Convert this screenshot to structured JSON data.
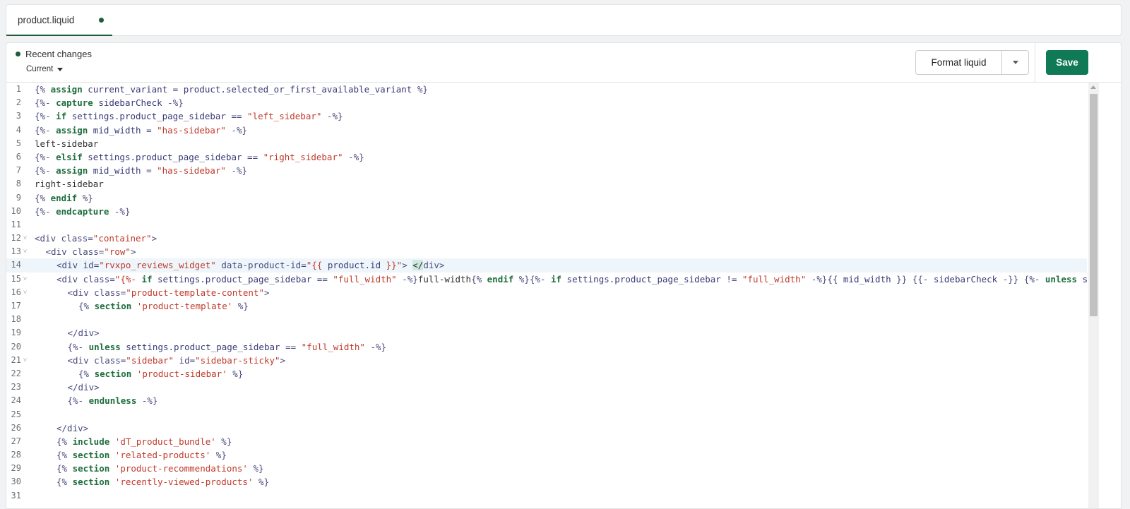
{
  "tabs": [
    {
      "label": "product.liquid",
      "unsaved": true
    }
  ],
  "toolbar": {
    "recent_changes_label": "Recent changes",
    "version_select": "Current",
    "format_label": "Format liquid",
    "save_label": "Save"
  },
  "editor": {
    "active_line": 14,
    "lines": [
      {
        "n": "1",
        "fold": false,
        "indent": 0,
        "parts": [
          [
            "mt",
            "{% "
          ],
          [
            "kw",
            "assign"
          ],
          [
            "vr",
            " current_variant "
          ],
          [
            "mt",
            "= "
          ],
          [
            "vr",
            "product.selected_or_first_available_variant"
          ],
          [
            "mt",
            " %}"
          ]
        ]
      },
      {
        "n": "2",
        "fold": false,
        "indent": 0,
        "parts": [
          [
            "mt",
            "{%- "
          ],
          [
            "kw",
            "capture"
          ],
          [
            "vr",
            " sidebarCheck"
          ],
          [
            "mt",
            " -%}"
          ]
        ]
      },
      {
        "n": "3",
        "fold": false,
        "indent": 0,
        "parts": [
          [
            "mt",
            "{%- "
          ],
          [
            "kw",
            "if"
          ],
          [
            "vr",
            " settings.product_page_sidebar "
          ],
          [
            "mt",
            "== "
          ],
          [
            "st",
            "\"left_sidebar\""
          ],
          [
            "mt",
            " -%}"
          ]
        ]
      },
      {
        "n": "4",
        "fold": false,
        "indent": 0,
        "parts": [
          [
            "mt",
            "{%- "
          ],
          [
            "kw",
            "assign"
          ],
          [
            "vr",
            " mid_width "
          ],
          [
            "mt",
            "= "
          ],
          [
            "st",
            "\"has-sidebar\""
          ],
          [
            "mt",
            " -%}"
          ]
        ]
      },
      {
        "n": "5",
        "fold": false,
        "indent": 0,
        "parts": [
          [
            "pl",
            "left-sidebar"
          ]
        ]
      },
      {
        "n": "6",
        "fold": false,
        "indent": 0,
        "parts": [
          [
            "mt",
            "{%- "
          ],
          [
            "kw",
            "elsif"
          ],
          [
            "vr",
            " settings.product_page_sidebar "
          ],
          [
            "mt",
            "== "
          ],
          [
            "st",
            "\"right_sidebar\""
          ],
          [
            "mt",
            " -%}"
          ]
        ]
      },
      {
        "n": "7",
        "fold": false,
        "indent": 0,
        "parts": [
          [
            "mt",
            "{%- "
          ],
          [
            "kw",
            "assign"
          ],
          [
            "vr",
            " mid_width "
          ],
          [
            "mt",
            "= "
          ],
          [
            "st",
            "\"has-sidebar\""
          ],
          [
            "mt",
            " -%}"
          ]
        ]
      },
      {
        "n": "8",
        "fold": false,
        "indent": 0,
        "parts": [
          [
            "pl",
            "right-sidebar"
          ]
        ]
      },
      {
        "n": "9",
        "fold": false,
        "indent": 0,
        "parts": [
          [
            "mt",
            "{% "
          ],
          [
            "kw",
            "endif"
          ],
          [
            "mt",
            " %}"
          ]
        ]
      },
      {
        "n": "10",
        "fold": false,
        "indent": 0,
        "parts": [
          [
            "mt",
            "{%- "
          ],
          [
            "kw",
            "endcapture"
          ],
          [
            "mt",
            " -%}"
          ]
        ]
      },
      {
        "n": "11",
        "fold": false,
        "indent": 0,
        "parts": []
      },
      {
        "n": "12",
        "fold": true,
        "indent": 0,
        "parts": [
          [
            "tg",
            "<div "
          ],
          [
            "at",
            "class="
          ],
          [
            "st",
            "\"container\""
          ],
          [
            "tg",
            ">"
          ]
        ]
      },
      {
        "n": "13",
        "fold": true,
        "indent": 1,
        "parts": [
          [
            "tg",
            "<div "
          ],
          [
            "at",
            "class="
          ],
          [
            "st",
            "\"row\""
          ],
          [
            "tg",
            ">"
          ]
        ]
      },
      {
        "n": "14",
        "fold": false,
        "indent": 2,
        "parts": [
          [
            "tg",
            "<div "
          ],
          [
            "at",
            "id="
          ],
          [
            "st",
            "\"rvxpo_reviews_widget\""
          ],
          [
            "at",
            " data-product-id="
          ],
          [
            "st",
            "\"{{ "
          ],
          [
            "vr",
            "product.id"
          ],
          [
            "st",
            " }}\""
          ],
          [
            "tg",
            "> "
          ],
          [
            "ht",
            "</"
          ],
          [
            "tg",
            "div>"
          ]
        ]
      },
      {
        "n": "15",
        "fold": true,
        "indent": 2,
        "parts": [
          [
            "tg",
            "<div "
          ],
          [
            "at",
            "class="
          ],
          [
            "st",
            "\"{%- "
          ],
          [
            "kw",
            "if"
          ],
          [
            "vr",
            " settings.product_page_sidebar "
          ],
          [
            "mt",
            "== "
          ],
          [
            "st",
            "\"full_width\""
          ],
          [
            "mt",
            " -%}"
          ],
          [
            "pl",
            "full-width"
          ],
          [
            "mt",
            "{% "
          ],
          [
            "kw",
            "endif"
          ],
          [
            "mt",
            " %}{%- "
          ],
          [
            "kw",
            "if"
          ],
          [
            "vr",
            " settings.product_page_sidebar "
          ],
          [
            "mt",
            "!= "
          ],
          [
            "st",
            "\"full_width\""
          ],
          [
            "mt",
            " -%}{{ "
          ],
          [
            "vr",
            "mid_width"
          ],
          [
            "mt",
            " }} {{- "
          ],
          [
            "vr",
            "sidebarCheck"
          ],
          [
            "mt",
            " -}} {%- "
          ],
          [
            "kw",
            "unless"
          ],
          [
            "vr",
            " se"
          ]
        ]
      },
      {
        "n": "16",
        "fold": true,
        "indent": 3,
        "parts": [
          [
            "tg",
            "<div "
          ],
          [
            "at",
            "class="
          ],
          [
            "st",
            "\"product-template-content\""
          ],
          [
            "tg",
            ">"
          ]
        ]
      },
      {
        "n": "17",
        "fold": false,
        "indent": 4,
        "parts": [
          [
            "mt",
            "{% "
          ],
          [
            "kw",
            "section"
          ],
          [
            "st",
            " 'product-template'"
          ],
          [
            "mt",
            " %}"
          ]
        ]
      },
      {
        "n": "18",
        "fold": false,
        "indent": 0,
        "parts": []
      },
      {
        "n": "19",
        "fold": false,
        "indent": 3,
        "parts": [
          [
            "tg",
            "</div>"
          ]
        ]
      },
      {
        "n": "20",
        "fold": false,
        "indent": 3,
        "parts": [
          [
            "mt",
            "{%- "
          ],
          [
            "kw",
            "unless"
          ],
          [
            "vr",
            " settings.product_page_sidebar "
          ],
          [
            "mt",
            "== "
          ],
          [
            "st",
            "\"full_width\""
          ],
          [
            "mt",
            " -%}"
          ]
        ]
      },
      {
        "n": "21",
        "fold": true,
        "indent": 3,
        "parts": [
          [
            "tg",
            "<div "
          ],
          [
            "at",
            "class="
          ],
          [
            "st",
            "\"sidebar\""
          ],
          [
            "at",
            " id="
          ],
          [
            "st",
            "\"sidebar-sticky\""
          ],
          [
            "tg",
            ">"
          ]
        ]
      },
      {
        "n": "22",
        "fold": false,
        "indent": 4,
        "parts": [
          [
            "mt",
            "{% "
          ],
          [
            "kw",
            "section"
          ],
          [
            "st",
            " 'product-sidebar'"
          ],
          [
            "mt",
            " %}"
          ]
        ]
      },
      {
        "n": "23",
        "fold": false,
        "indent": 3,
        "parts": [
          [
            "tg",
            "</div>"
          ]
        ]
      },
      {
        "n": "24",
        "fold": false,
        "indent": 3,
        "parts": [
          [
            "mt",
            "{%- "
          ],
          [
            "kw",
            "endunless"
          ],
          [
            "mt",
            " -%}"
          ]
        ]
      },
      {
        "n": "25",
        "fold": false,
        "indent": 0,
        "parts": []
      },
      {
        "n": "26",
        "fold": false,
        "indent": 2,
        "parts": [
          [
            "tg",
            "</div>"
          ]
        ]
      },
      {
        "n": "27",
        "fold": false,
        "indent": 2,
        "parts": [
          [
            "mt",
            "{% "
          ],
          [
            "kw",
            "include"
          ],
          [
            "st",
            " 'dT_product_bundle'"
          ],
          [
            "mt",
            " %}"
          ]
        ]
      },
      {
        "n": "28",
        "fold": false,
        "indent": 2,
        "parts": [
          [
            "mt",
            "{% "
          ],
          [
            "kw",
            "section"
          ],
          [
            "st",
            " 'related-products'"
          ],
          [
            "mt",
            " %}"
          ]
        ]
      },
      {
        "n": "29",
        "fold": false,
        "indent": 2,
        "parts": [
          [
            "mt",
            "{% "
          ],
          [
            "kw",
            "section"
          ],
          [
            "st",
            " 'product-recommendations'"
          ],
          [
            "mt",
            " %}"
          ]
        ]
      },
      {
        "n": "30",
        "fold": false,
        "indent": 2,
        "parts": [
          [
            "mt",
            "{% "
          ],
          [
            "kw",
            "section"
          ],
          [
            "st",
            " 'recently-viewed-products'"
          ],
          [
            "mt",
            " %}"
          ]
        ]
      },
      {
        "n": "31",
        "fold": false,
        "indent": 0,
        "parts": []
      }
    ]
  },
  "colors": {
    "accent": "#1f5c3a",
    "save_bg": "#0f7a55",
    "keyword": "#1f6e3e",
    "string": "#c0392b",
    "active_line": "#eef6fb"
  },
  "icons": {
    "unsaved": "dot-icon",
    "dropdown": "caret-down-icon",
    "fold": "chevron-down-icon"
  }
}
